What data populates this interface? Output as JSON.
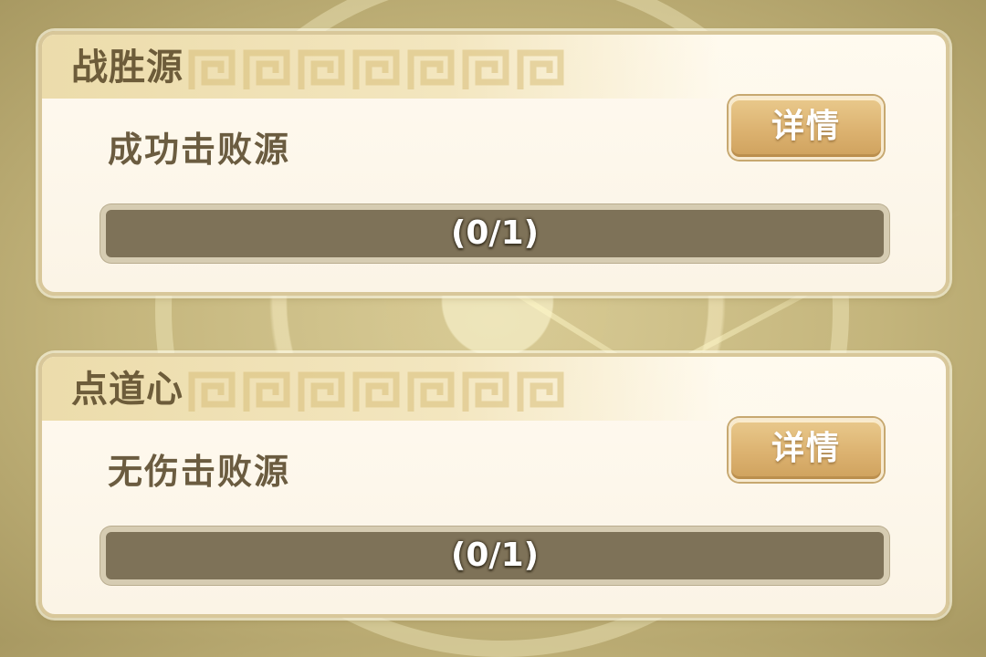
{
  "achievements": [
    {
      "title": "战胜源",
      "description": "成功击败源",
      "button_label": "详情",
      "progress": {
        "current": 0,
        "total": 1,
        "text": "(0/1)"
      }
    },
    {
      "title": "点道心",
      "description": "无伤击败源",
      "button_label": "详情",
      "progress": {
        "current": 0,
        "total": 1,
        "text": "(0/1)"
      }
    }
  ],
  "colors": {
    "card_background": "#fffaf0",
    "title_text": "#6d5c3a",
    "button_gold": "#dcb270",
    "progress_track": "#7e7258",
    "progress_fill": "#d9ad4c"
  },
  "icons": [
    "greek-key-pattern-icon"
  ]
}
